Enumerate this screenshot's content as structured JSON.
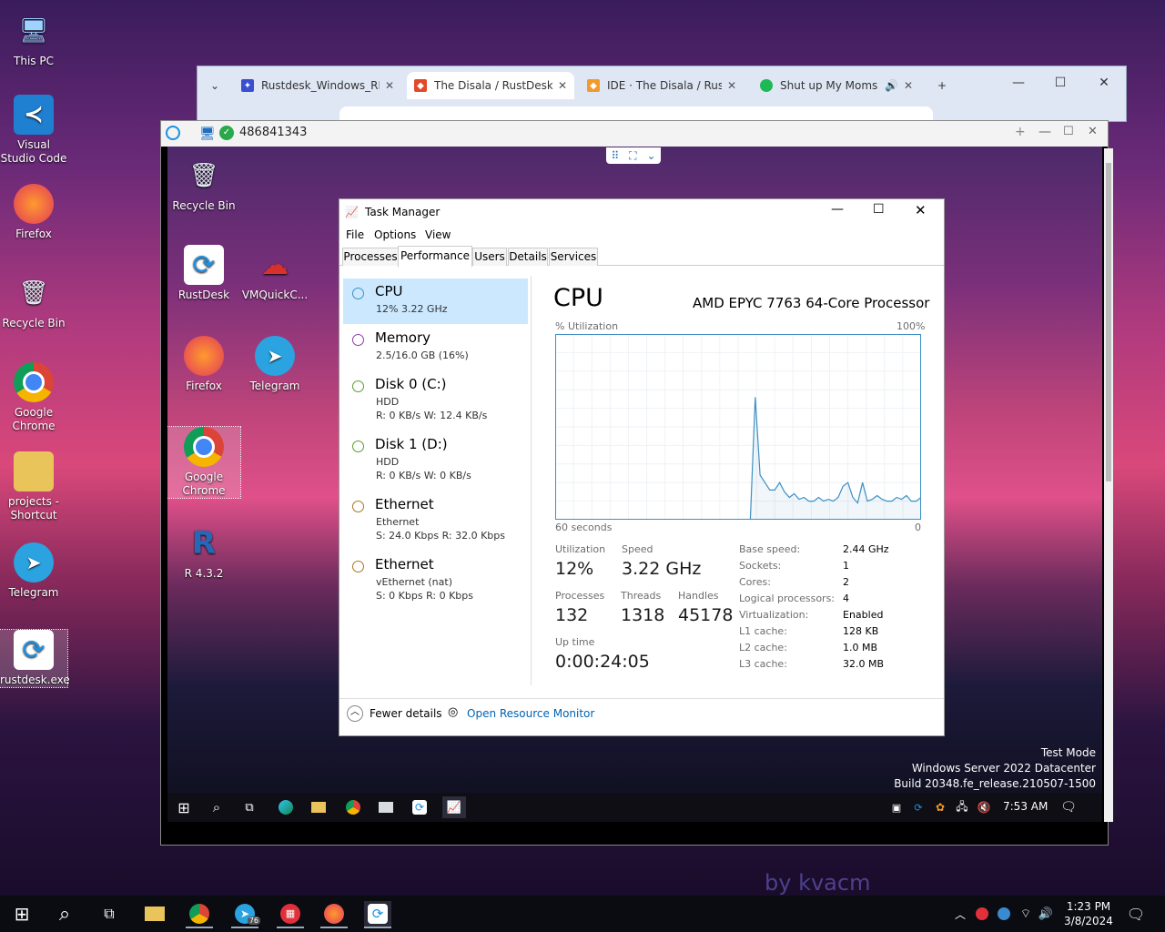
{
  "desktop": {
    "icons": [
      {
        "label": "This PC"
      },
      {
        "label": "Visual Studio Code"
      },
      {
        "label": "Firefox"
      },
      {
        "label": "Recycle Bin"
      },
      {
        "label": "Google Chrome"
      },
      {
        "label": "projects - Shortcut"
      },
      {
        "label": "Telegram"
      },
      {
        "label": "rustdesk.exe"
      }
    ],
    "watermark": "by kvacm"
  },
  "browser": {
    "tabs": [
      {
        "title": "Rustdesk_Windows_RD"
      },
      {
        "title": "The Disala / RustDesk_"
      },
      {
        "title": "IDE · The Disala / Rust"
      },
      {
        "title": "Shut up My Moms"
      }
    ],
    "new_tab": "+",
    "dropdown": "⌄"
  },
  "rustdesk": {
    "peer_id": "486841343"
  },
  "remote": {
    "icons": [
      {
        "label": "Recycle Bin"
      },
      {
        "label": "RustDesk"
      },
      {
        "label": "VMQuickC..."
      },
      {
        "label": "Firefox"
      },
      {
        "label": "Telegram"
      },
      {
        "label": "Google Chrome"
      },
      {
        "label": "R 4.3.2"
      }
    ],
    "watermark": {
      "line1": "Test Mode",
      "line2": "Windows Server 2022 Datacenter",
      "line3": "Build 20348.fe_release.210507-1500"
    },
    "clock": "7:53 AM"
  },
  "taskmanager": {
    "title": "Task Manager",
    "menu": [
      "File",
      "Options",
      "View"
    ],
    "tabs": [
      "Processes",
      "Performance",
      "Users",
      "Details",
      "Services"
    ],
    "resources": [
      {
        "name": "CPU",
        "l1": "12% 3.22 GHz",
        "l2": "",
        "color": "#3d8fc4"
      },
      {
        "name": "Memory",
        "l1": "2.5/16.0 GB (16%)",
        "l2": "",
        "color": "#8b3da8"
      },
      {
        "name": "Disk 0 (C:)",
        "l1": "HDD",
        "l2": "R: 0 KB/s W: 12.4 KB/s",
        "color": "#5a9e2f"
      },
      {
        "name": "Disk 1 (D:)",
        "l1": "HDD",
        "l2": "R: 0 KB/s W: 0 KB/s",
        "color": "#5a9e2f"
      },
      {
        "name": "Ethernet",
        "l1": "Ethernet",
        "l2": "S: 24.0 Kbps R: 32.0 Kbps",
        "color": "#a7771f"
      },
      {
        "name": "Ethernet",
        "l1": "vEthernet (nat)",
        "l2": "S: 0 Kbps R: 0 Kbps",
        "color": "#a7771f"
      }
    ],
    "cpu": {
      "heading": "CPU",
      "model": "AMD EPYC 7763 64-Core Processor",
      "util_label": "% Utilization",
      "util_max": "100%",
      "time_left": "60 seconds",
      "time_right": "0",
      "utilization_label": "Utilization",
      "utilization": "12%",
      "speed_label": "Speed",
      "speed": "3.22 GHz",
      "processes_label": "Processes",
      "processes": "132",
      "threads_label": "Threads",
      "threads": "1318",
      "handles_label": "Handles",
      "handles": "45178",
      "uptime_label": "Up time",
      "uptime": "0:00:24:05",
      "specs": [
        {
          "k": "Base speed:",
          "v": "2.44 GHz"
        },
        {
          "k": "Sockets:",
          "v": "1"
        },
        {
          "k": "Cores:",
          "v": "2"
        },
        {
          "k": "Logical processors:",
          "v": "4"
        },
        {
          "k": "Virtualization:",
          "v": "Enabled"
        },
        {
          "k": "L1 cache:",
          "v": "128 KB"
        },
        {
          "k": "L2 cache:",
          "v": "1.0 MB"
        },
        {
          "k": "L3 cache:",
          "v": "32.0 MB"
        }
      ]
    },
    "fewer_details": "Fewer details",
    "open_monitor": "Open Resource Monitor"
  },
  "chart_data": {
    "type": "line",
    "x": [
      60,
      59,
      58,
      57,
      56,
      55,
      54,
      53,
      52,
      51,
      50,
      49,
      48,
      47,
      46,
      45,
      44,
      43,
      42,
      41,
      40,
      39,
      38,
      37,
      36,
      35,
      34,
      33,
      32,
      31,
      30,
      29,
      28,
      27,
      26,
      25,
      24,
      23,
      22,
      21,
      20,
      19,
      18,
      17,
      16,
      15,
      14,
      13,
      12,
      11,
      10,
      9,
      8,
      7,
      6,
      5,
      4,
      3,
      2,
      1,
      0
    ],
    "values": [
      0,
      0,
      0,
      0,
      0,
      0,
      0,
      0,
      0,
      0,
      0,
      0,
      0,
      0,
      0,
      0,
      0,
      0,
      0,
      0,
      0,
      0,
      0,
      0,
      0,
      0,
      0,
      0,
      0,
      0,
      0,
      0,
      0,
      0,
      0,
      0,
      0,
      0,
      0,
      0,
      0,
      66,
      24,
      20,
      16,
      16,
      20,
      15,
      12,
      14,
      11,
      12,
      10,
      10,
      12,
      10,
      11,
      10,
      12,
      18,
      20,
      12,
      9,
      20,
      10,
      11,
      13,
      11,
      10,
      10,
      12,
      11,
      13,
      10,
      10,
      12
    ],
    "ylim": [
      0,
      100
    ],
    "xlabel": "60 seconds",
    "ylabel": "% Utilization",
    "color": "#3d8fc4"
  },
  "main_taskbar": {
    "time": "1:23 PM",
    "date": "3/8/2024",
    "telegram_badge": "76"
  }
}
